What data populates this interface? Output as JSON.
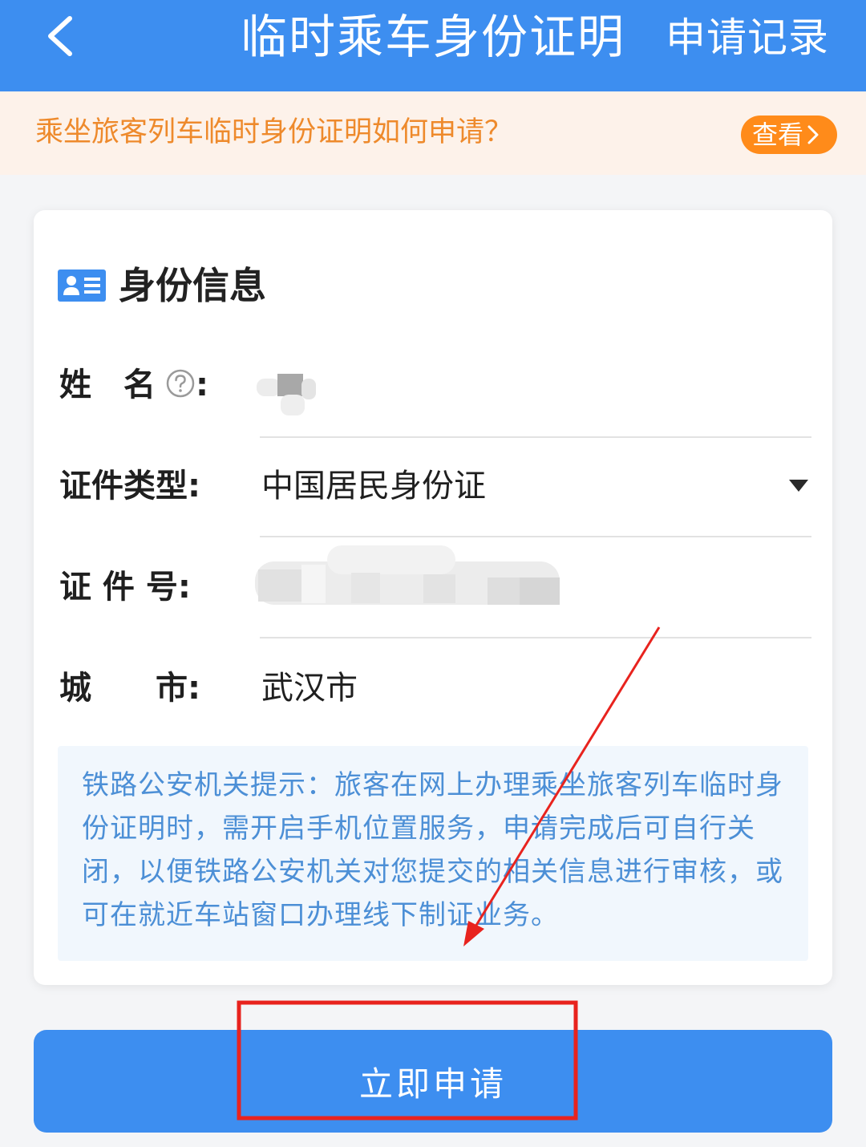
{
  "header": {
    "title": "临时乘车身份证明",
    "records_label": "申请记录"
  },
  "notice": {
    "text": "乘坐旅客列车临时身份证明如何申请？",
    "button_label": "查看"
  },
  "identity": {
    "section_title": "身份信息",
    "name_label": "姓　名",
    "name_colon": ":",
    "doc_type_label": "证件类型:",
    "doc_type_value": "中国居民身份证",
    "doc_number_label": "证 件 号:",
    "city_label": "城　　市:",
    "city_value": "武汉市"
  },
  "tip": {
    "text": "铁路公安机关提示：旅客在网上办理乘坐旅客列车临时身份证明时，需开启手机位置服务，申请完成后可自行关闭，以便铁路公安机关对您提交的相关信息进行审核，或可在就近车站窗口办理线下制证业务。"
  },
  "submit": {
    "label": "立即申请"
  },
  "colors": {
    "primary": "#3d8ef0",
    "notice_bg": "#fdf2ea",
    "notice_text": "#ee8a2c",
    "notice_button": "#ff8b1a",
    "tip_bg": "#f1f7fd",
    "tip_text": "#4c8fd6",
    "annotation": "#e8231e"
  },
  "icons": {
    "back": "chevron-left-icon",
    "notice_arrow": "chevron-right-icon",
    "section": "id-card-icon",
    "help": "question-circle-icon",
    "dropdown": "caret-down-icon"
  }
}
